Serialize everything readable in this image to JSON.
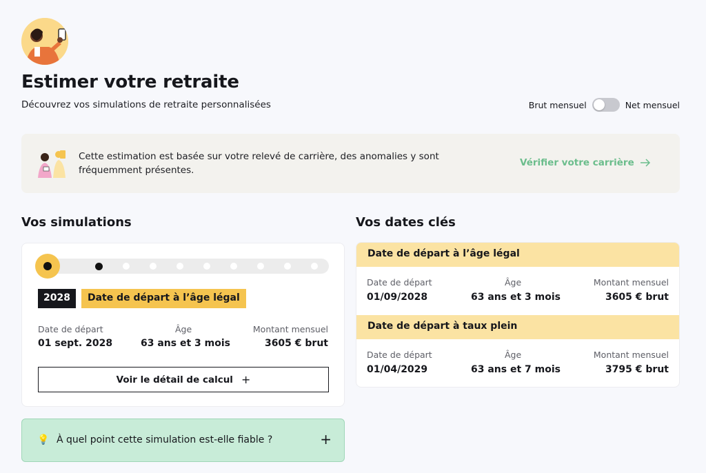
{
  "header": {
    "title": "Estimer votre retraite",
    "subtitle": "Découvrez vos simulations de retraite personnalisées"
  },
  "toggle": {
    "left_label": "Brut mensuel",
    "right_label": "Net mensuel",
    "state": "off"
  },
  "banner": {
    "text": "Cette estimation est basée sur votre relevé de carrière, des anomalies y sont fréquemment présentes.",
    "link_label": "Vérifier votre carrière"
  },
  "simulations": {
    "title": "Vos simulations",
    "timeline_points": 11,
    "active_index": 0,
    "year": "2028",
    "scenario": "Date de départ à l’âge légal",
    "columns": [
      "Date de départ",
      "Âge",
      "Montant mensuel"
    ],
    "values": [
      "01 sept. 2028",
      "63 ans et 3 mois",
      "3605 € brut"
    ],
    "detail_button": "Voir le détail de calcul",
    "faq_label": "À quel point cette simulation est-elle fiable ?"
  },
  "key_dates": {
    "title": "Vos dates clés",
    "items": [
      {
        "heading": "Date de départ à l’âge légal",
        "labels": [
          "Date de départ",
          "Âge",
          "Montant mensuel"
        ],
        "values": [
          "01/09/2028",
          "63 ans et 3 mois",
          "3605 € brut"
        ]
      },
      {
        "heading": "Date de départ à taux plein",
        "labels": [
          "Date de départ",
          "Âge",
          "Montant mensuel"
        ],
        "values": [
          "01/04/2029",
          "63 ans et 7 mois",
          "3795 € brut"
        ]
      }
    ]
  },
  "colors": {
    "accent_yellow": "#f5c44f",
    "link_green": "#6bbd8c",
    "faq_green": "#c8ecd8",
    "dates_header": "#fbe3a3"
  }
}
